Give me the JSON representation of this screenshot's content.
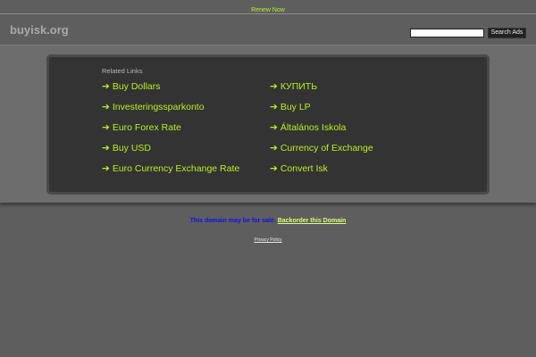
{
  "topbar": {
    "renew_label": "Renew Now"
  },
  "header": {
    "logo": "buyisk.org",
    "search_value": "",
    "search_button_label": "Search Ads"
  },
  "related": {
    "title": "Related Links",
    "arrow_glyph": "➔",
    "left": [
      "Buy Dollars",
      "Investeringssparkonto",
      "Euro Forex Rate",
      "Buy USD",
      "Euro Currency Exchange Rate"
    ],
    "right": [
      "КУПИТЬ",
      "Buy LP",
      "Általános Iskola",
      "Currency of Exchange",
      "Convert Isk"
    ]
  },
  "footer": {
    "sale_text": "This domain may be for sale.",
    "backorder_label": "Backorder this Domain",
    "privacy_label": "Privacy Policy"
  },
  "colors": {
    "link": "#b9f026",
    "background": "#5e5e5e",
    "panel": "#333333",
    "sale": "#1010e8"
  }
}
